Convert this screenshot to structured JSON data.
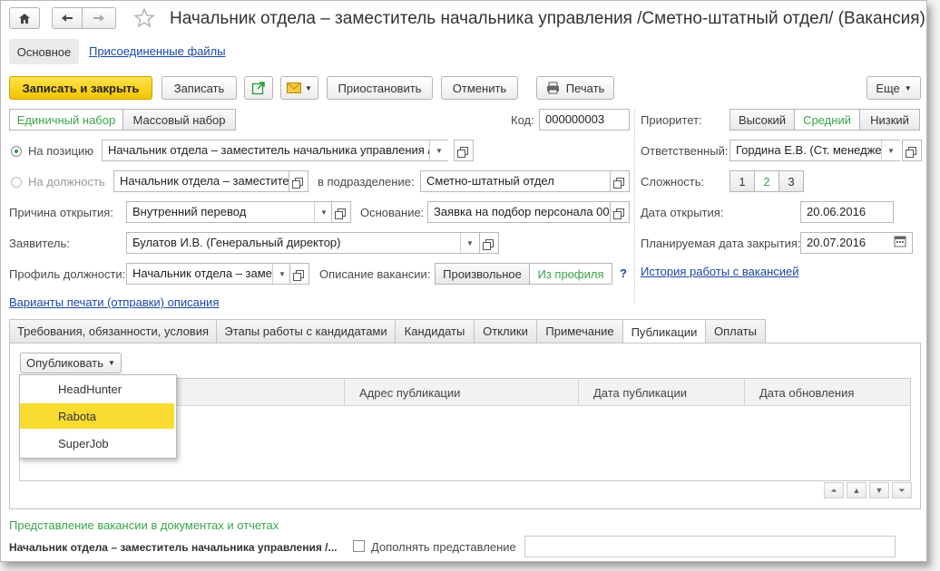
{
  "window": {
    "title": "Начальник отдела – заместитель начальника управления /Сметно-штатный отдел/ (Вакансия)"
  },
  "nav_tabs": {
    "main": "Основное",
    "files": "Присоединенные файлы"
  },
  "toolbar": {
    "save_close": "Записать и закрыть",
    "save": "Записать",
    "suspend": "Приостановить",
    "cancel": "Отменить",
    "print": "Печать",
    "more": "Еще"
  },
  "mode": {
    "single": "Единичный набор",
    "mass": "Массовый набор"
  },
  "code": {
    "label": "Код:",
    "value": "000000003"
  },
  "priority": {
    "label": "Приоритет:",
    "high": "Высокий",
    "medium": "Средний",
    "low": "Низкий"
  },
  "position": {
    "label": "На позицию",
    "value": "Начальник отдела – заместитель начальника управления /С"
  },
  "post": {
    "label": "На должность",
    "value": "Начальник отдела – заместител",
    "dept_label": "в подразделение:",
    "dept_value": "Сметно-штатный отдел"
  },
  "responsible": {
    "label": "Ответственный:",
    "value": "Гордина Е.В. (Ст. менедже"
  },
  "complexity": {
    "label": "Сложность:",
    "v1": "1",
    "v2": "2",
    "v3": "3"
  },
  "reason": {
    "label": "Причина открытия:",
    "value": "Внутренний перевод",
    "basis_label": "Основание:",
    "basis_value": "Заявка на подбор персонала 000("
  },
  "open_date": {
    "label": "Дата открытия:",
    "value": "20.06.2016"
  },
  "applicant": {
    "label": "Заявитель:",
    "value": "Булатов И.В. (Генеральный директор)"
  },
  "close_date": {
    "label": "Планируемая дата закрытия:",
    "value": "20.07.2016"
  },
  "profile": {
    "label": "Профиль должности:",
    "value": "Начальник отдела – заме",
    "desc_label": "Описание вакансии:",
    "desc_free": "Произвольное",
    "desc_profile": "Из профиля",
    "help": "?"
  },
  "history_link": "История работы с вакансией",
  "print_variants_link": "Варианты печати (отправки) описания",
  "tabs": [
    "Требования, обязанности, условия",
    "Этапы работы с кандидатами",
    "Кандидаты",
    "Отклики",
    "Примечание",
    "Публикации",
    "Оплаты"
  ],
  "publish_button": "Опубликовать",
  "publish_menu": [
    "HeadHunter",
    "Rabota",
    "SuperJob"
  ],
  "table_columns": [
    "",
    "Адрес публикации",
    "Дата публикации",
    "Дата обновления"
  ],
  "representation": {
    "section_title": "Представление вакансии в документах и отчетах",
    "value": "Начальник отдела – заместитель начальника управления /...",
    "checkbox_label": "Дополнять представление"
  },
  "colors": {
    "accent": "#f3c300",
    "link": "#1b47a8",
    "green": "#3aa54a"
  }
}
